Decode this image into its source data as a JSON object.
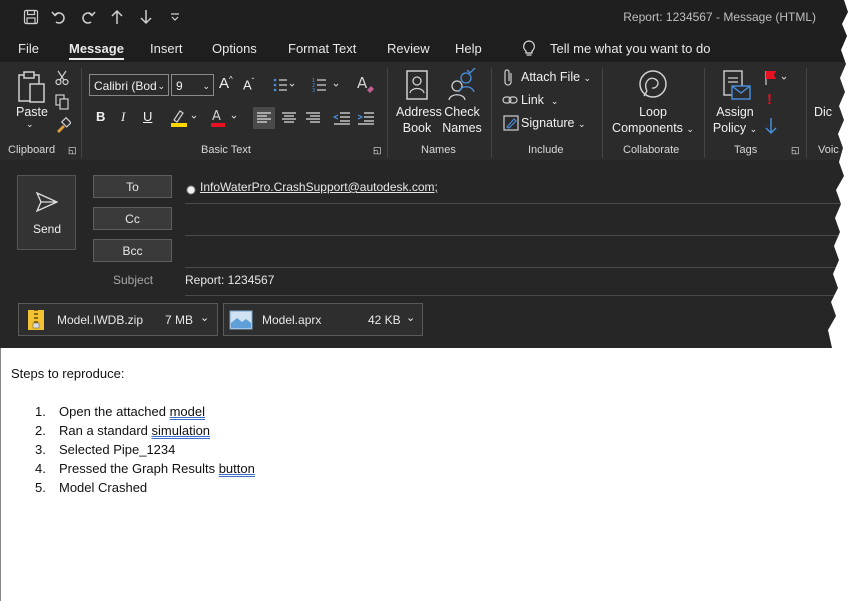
{
  "title": "Report: 1234567  -  Message (HTML)",
  "menu": [
    "File",
    "Message",
    "Insert",
    "Options",
    "Format Text",
    "Review",
    "Help"
  ],
  "tellme": "Tell me what you want to do",
  "ribbon": {
    "clipboard": {
      "paste": "Paste",
      "group": "Clipboard"
    },
    "basic_text": {
      "font": "Calibri (Bod",
      "size": "9",
      "group": "Basic Text",
      "bold": "B",
      "italic": "I",
      "underline": "U",
      "fontcolor": "A",
      "grow": "A",
      "shrink": "A"
    },
    "names": {
      "address_book_1": "Address",
      "address_book_2": "Book",
      "check_names_1": "Check",
      "check_names_2": "Names",
      "group": "Names"
    },
    "include": {
      "attach": "Attach File",
      "link": "Link",
      "signature": "Signature",
      "group": "Include"
    },
    "collaborate": {
      "loop_1": "Loop",
      "loop_2": "Components",
      "group": "Collaborate"
    },
    "tags": {
      "assign_1": "Assign",
      "assign_2": "Policy",
      "group": "Tags"
    },
    "voice": {
      "dictate": "Dic",
      "group": "Voic"
    }
  },
  "header": {
    "send": "Send",
    "to_label": "To",
    "cc_label": "Cc",
    "bcc_label": "Bcc",
    "to_value": "InfoWaterPro.CrashSupport@autodesk.com;",
    "subject_label": "Subject",
    "subject_value": "Report: 1234567"
  },
  "attachments": [
    {
      "name": "Model.IWDB.zip",
      "size": "7 MB"
    },
    {
      "name": "Model.aprx",
      "size": "42 KB"
    }
  ],
  "body": {
    "intro": "Steps to reproduce:",
    "steps": [
      {
        "num": "1.",
        "pre": "Open the attached ",
        "link": "model"
      },
      {
        "num": "2.",
        "pre": "Ran a standard ",
        "link": "simulation"
      },
      {
        "num": "3.",
        "pre": "Selected Pipe_1234",
        "link": ""
      },
      {
        "num": "4.",
        "pre": "Pressed the Graph Results ",
        "link": "button"
      },
      {
        "num": "5.",
        "pre": "Model Crashed",
        "link": ""
      }
    ]
  },
  "colors": {
    "accent": "#ffd700",
    "red": "#e81123",
    "blue": "#4a90e2"
  }
}
